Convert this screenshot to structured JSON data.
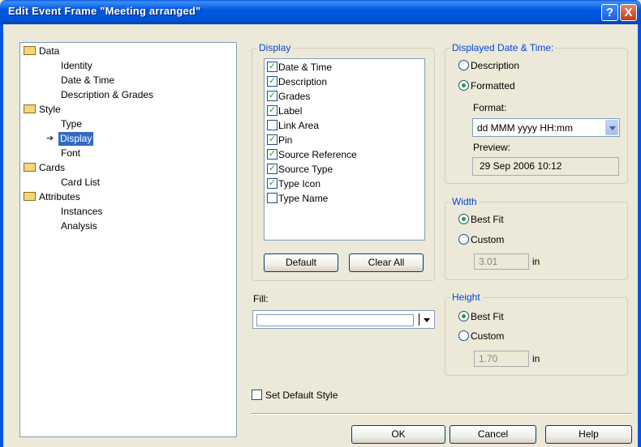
{
  "window": {
    "title": "Edit Event Frame \"Meeting arranged\"",
    "help_label": "?",
    "close_label": "X"
  },
  "tree": {
    "items": [
      {
        "label": "Data",
        "level": 0,
        "folder": true
      },
      {
        "label": "Identity",
        "level": 1
      },
      {
        "label": "Date & Time",
        "level": 1
      },
      {
        "label": "Description & Grades",
        "level": 1
      },
      {
        "label": "Style",
        "level": 0,
        "folder": true
      },
      {
        "label": "Type",
        "level": 1
      },
      {
        "label": "Display",
        "level": 1,
        "selected": true
      },
      {
        "label": "Font",
        "level": 1
      },
      {
        "label": "Cards",
        "level": 0,
        "folder": true
      },
      {
        "label": "Card List",
        "level": 1
      },
      {
        "label": "Attributes",
        "level": 0,
        "folder": true
      },
      {
        "label": "Instances",
        "level": 1
      },
      {
        "label": "Analysis",
        "level": 1
      }
    ]
  },
  "display": {
    "legend": "Display",
    "items": [
      {
        "label": "Date & Time",
        "checked": true
      },
      {
        "label": "Description",
        "checked": true
      },
      {
        "label": "Grades",
        "checked": true
      },
      {
        "label": "Label",
        "checked": true
      },
      {
        "label": "Link Area",
        "checked": false
      },
      {
        "label": "Pin",
        "checked": true
      },
      {
        "label": "Source Reference",
        "checked": true
      },
      {
        "label": "Source Type",
        "checked": true
      },
      {
        "label": "Type Icon",
        "checked": true
      },
      {
        "label": "Type Name",
        "checked": false
      }
    ],
    "default_label": "Default",
    "clear_all_label": "Clear All"
  },
  "fill": {
    "label": "Fill:",
    "value": ""
  },
  "date_time": {
    "legend": "Displayed Date & Time:",
    "description_label": "Description",
    "formatted_label": "Formatted",
    "selected": "formatted",
    "format_label": "Format:",
    "format_value": "dd MMM yyyy HH:mm",
    "preview_label": "Preview:",
    "preview_value": "29 Sep 2006 10:12"
  },
  "width": {
    "legend": "Width",
    "best_fit_label": "Best Fit",
    "custom_label": "Custom",
    "selected": "best_fit",
    "value": "3.01",
    "unit": "in"
  },
  "height": {
    "legend": "Height",
    "best_fit_label": "Best Fit",
    "custom_label": "Custom",
    "selected": "best_fit",
    "value": "1.70",
    "unit": "in"
  },
  "set_default_style": {
    "label": "Set Default Style",
    "checked": false
  },
  "footer": {
    "ok_label": "OK",
    "cancel_label": "Cancel",
    "help_label": "Help"
  },
  "colors": {
    "titlebar": "#0055E5",
    "dialog_bg": "#ECE9D8",
    "legend_text": "#0046D5",
    "selection": "#316AC5",
    "check_mark": "#21A121"
  }
}
